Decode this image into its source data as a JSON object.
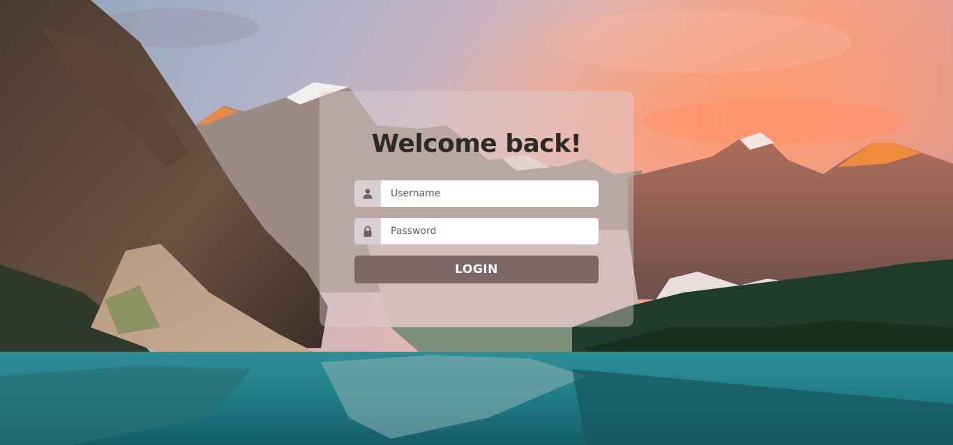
{
  "login": {
    "title": "Welcome back!",
    "username_placeholder": "Username",
    "password_placeholder": "Password",
    "button_label": "LOGIN"
  },
  "icons": {
    "username": "user-icon",
    "password": "lock-icon"
  },
  "colors": {
    "button_background": "#7d6868",
    "title_text": "#2c2a26"
  }
}
